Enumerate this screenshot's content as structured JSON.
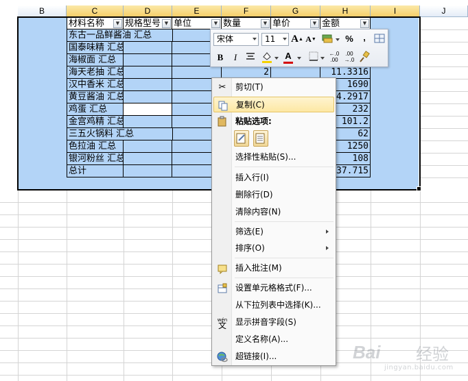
{
  "columns": {
    "B": "B",
    "C": "C",
    "D": "D",
    "E": "E",
    "F": "F",
    "G": "G",
    "H": "H",
    "I": "I",
    "J": "J"
  },
  "table": {
    "headers": [
      "材料名称",
      "规格型号",
      "单位",
      "数量",
      "单价",
      "金额"
    ],
    "rows": [
      {
        "name": "东古一品鲜酱油 汇总",
        "qty": "",
        "amount": ""
      },
      {
        "name": "国泰味精 汇总",
        "qty": "",
        "amount": ""
      },
      {
        "name": "海椒面 汇总",
        "qty": "",
        "amount": ""
      },
      {
        "name": "海天老抽 汇总",
        "qty": "2",
        "amount": "11.3316"
      },
      {
        "name": "汉中香米 汇总",
        "qty": "",
        "amount": "1690"
      },
      {
        "name": "黄豆酱油 汇总",
        "qty": "",
        "amount": "4.2917"
      },
      {
        "name": "鸡蛋 汇总",
        "qty": "",
        "amount": "232"
      },
      {
        "name": "金宫鸡精 汇总",
        "qty": "",
        "amount": "101.2"
      },
      {
        "name": "三五火锅料 汇总",
        "qty": "",
        "amount": "62"
      },
      {
        "name": "色拉油 汇总",
        "qty": "",
        "amount": "1250"
      },
      {
        "name": "银河粉丝 汇总",
        "qty": "",
        "amount": "108"
      },
      {
        "name": "总计",
        "qty": "",
        "amount": "37.715"
      }
    ]
  },
  "mini_toolbar": {
    "font_name": "宋体",
    "font_size": "11",
    "grow_font": "A",
    "shrink_font": "A",
    "percent": "%",
    "comma": ",",
    "bold": "B",
    "italic": "I",
    "font_color_letter": "A",
    "inc_decimal": "←.0\n.00",
    "dec_decimal": ".00\n→.0",
    "accent_highlight": "#f5d200",
    "accent_font_color": "#d40000"
  },
  "context_menu": {
    "cut": "剪切(T)",
    "copy": "复制(C)",
    "paste_options": "粘贴选项:",
    "paste_special": "选择性粘贴(S)...",
    "insert_row": "插入行(I)",
    "delete_row": "删除行(D)",
    "clear_contents": "清除内容(N)",
    "filter": "筛选(E)",
    "sort": "排序(O)",
    "insert_comment": "插入批注(M)",
    "format_cells": "设置单元格格式(F)...",
    "pick_from_list": "从下拉列表中选择(K)...",
    "phonetic": "显示拼音字段(S)",
    "define_name": "定义名称(A)...",
    "hyperlink": "超链接(I)..."
  },
  "watermark": {
    "brand": "Bai",
    "brand_cn": "经验",
    "url": "jingyan.baidu.com"
  }
}
